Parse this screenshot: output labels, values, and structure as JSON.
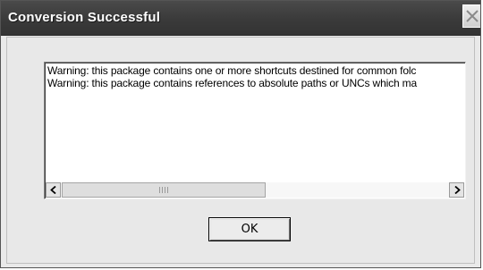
{
  "window": {
    "title": "Conversion Successful",
    "close_icon": "close-icon"
  },
  "messages": [
    "Warning: this package contains one or more shortcuts destined for common folc",
    "Warning: this package contains references to absolute paths or UNCs which ma"
  ],
  "scrollbar": {
    "left_icon": "chevron-left-icon",
    "right_icon": "chevron-right-icon",
    "thumb_fraction": 0.52
  },
  "buttons": {
    "ok_label": "OK"
  }
}
